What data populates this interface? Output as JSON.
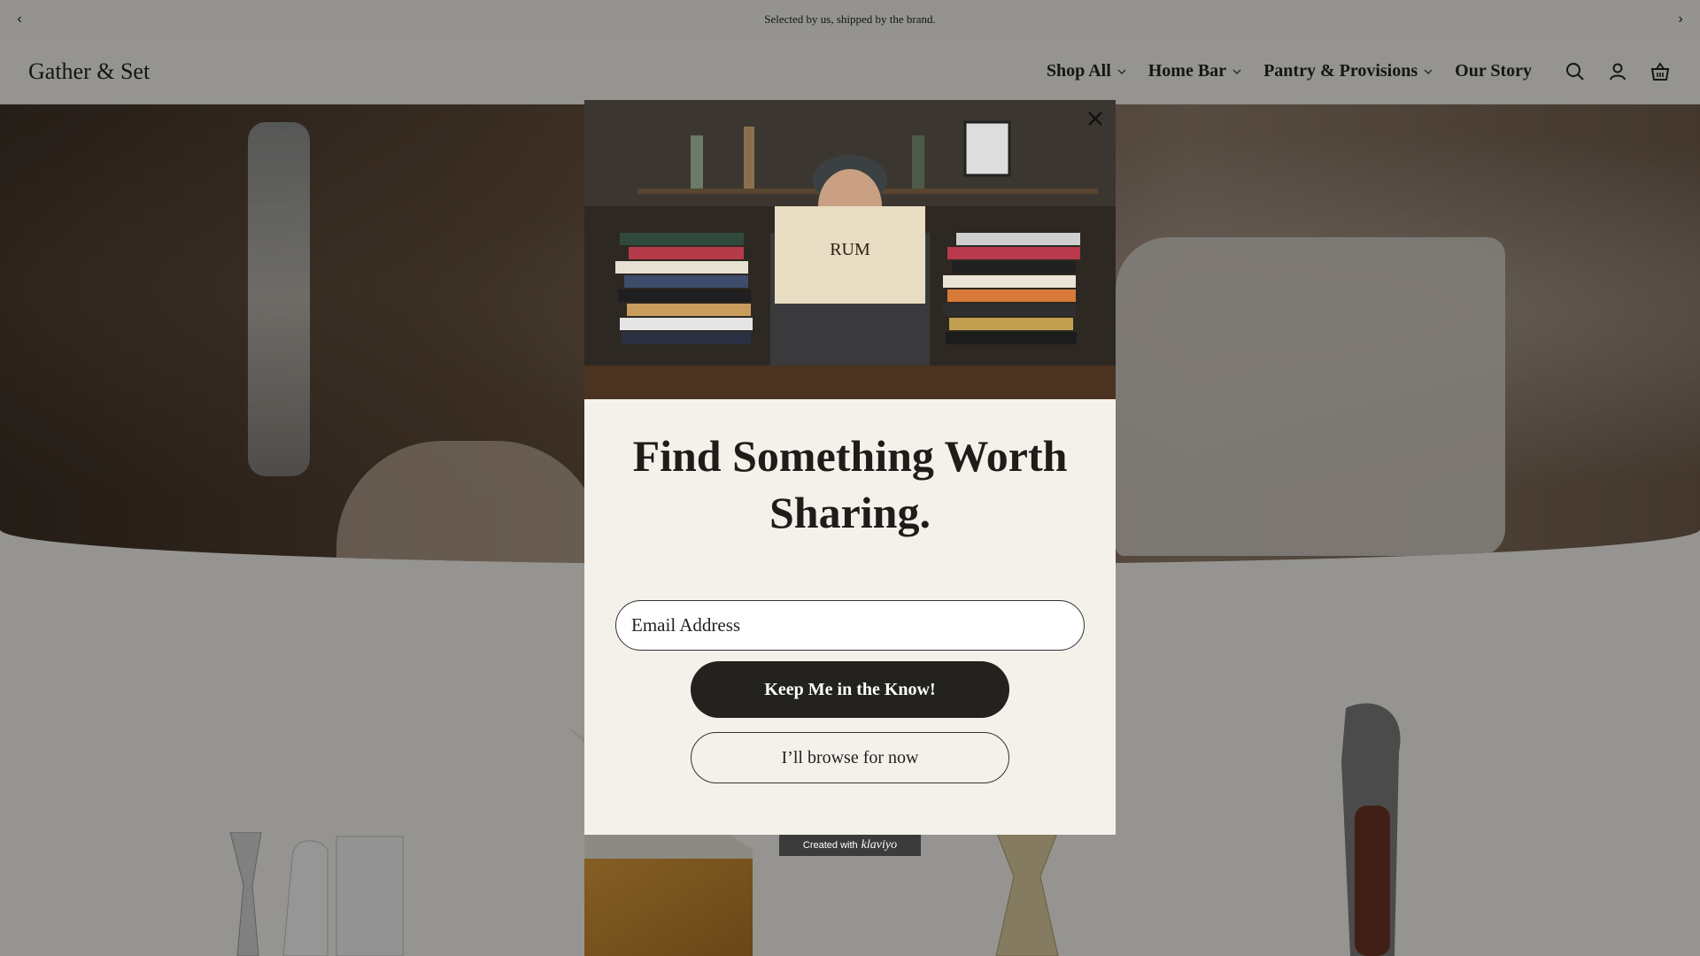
{
  "announcement": {
    "text": "Selected by us, shipped by the brand.",
    "prev_icon": "chevron-left-icon",
    "next_icon": "chevron-right-icon"
  },
  "header": {
    "logo": "Gather & Set",
    "nav": [
      {
        "label": "Shop All",
        "has_dropdown": true
      },
      {
        "label": "Home Bar",
        "has_dropdown": true
      },
      {
        "label": "Pantry & Provisions",
        "has_dropdown": true
      },
      {
        "label": "Our Story",
        "has_dropdown": false
      }
    ],
    "icons": [
      "search-icon",
      "account-icon",
      "cart-icon"
    ]
  },
  "popup": {
    "image_icon": "person-reading-books-photo",
    "headline": "Find Something Worth Sharing.",
    "email_placeholder": "Email Address",
    "submit_label": "Keep Me in the Know!",
    "dismiss_label": "I’ll browse for now",
    "close_icon": "close-icon",
    "badge_prefix": "Created with",
    "badge_brand": "klaviyo"
  },
  "colors": {
    "background": "#f1efe9",
    "modal_bg": "#f3f1ea",
    "button_dark": "#24221e",
    "overlay": "rgba(0,0,0,0.38)"
  }
}
